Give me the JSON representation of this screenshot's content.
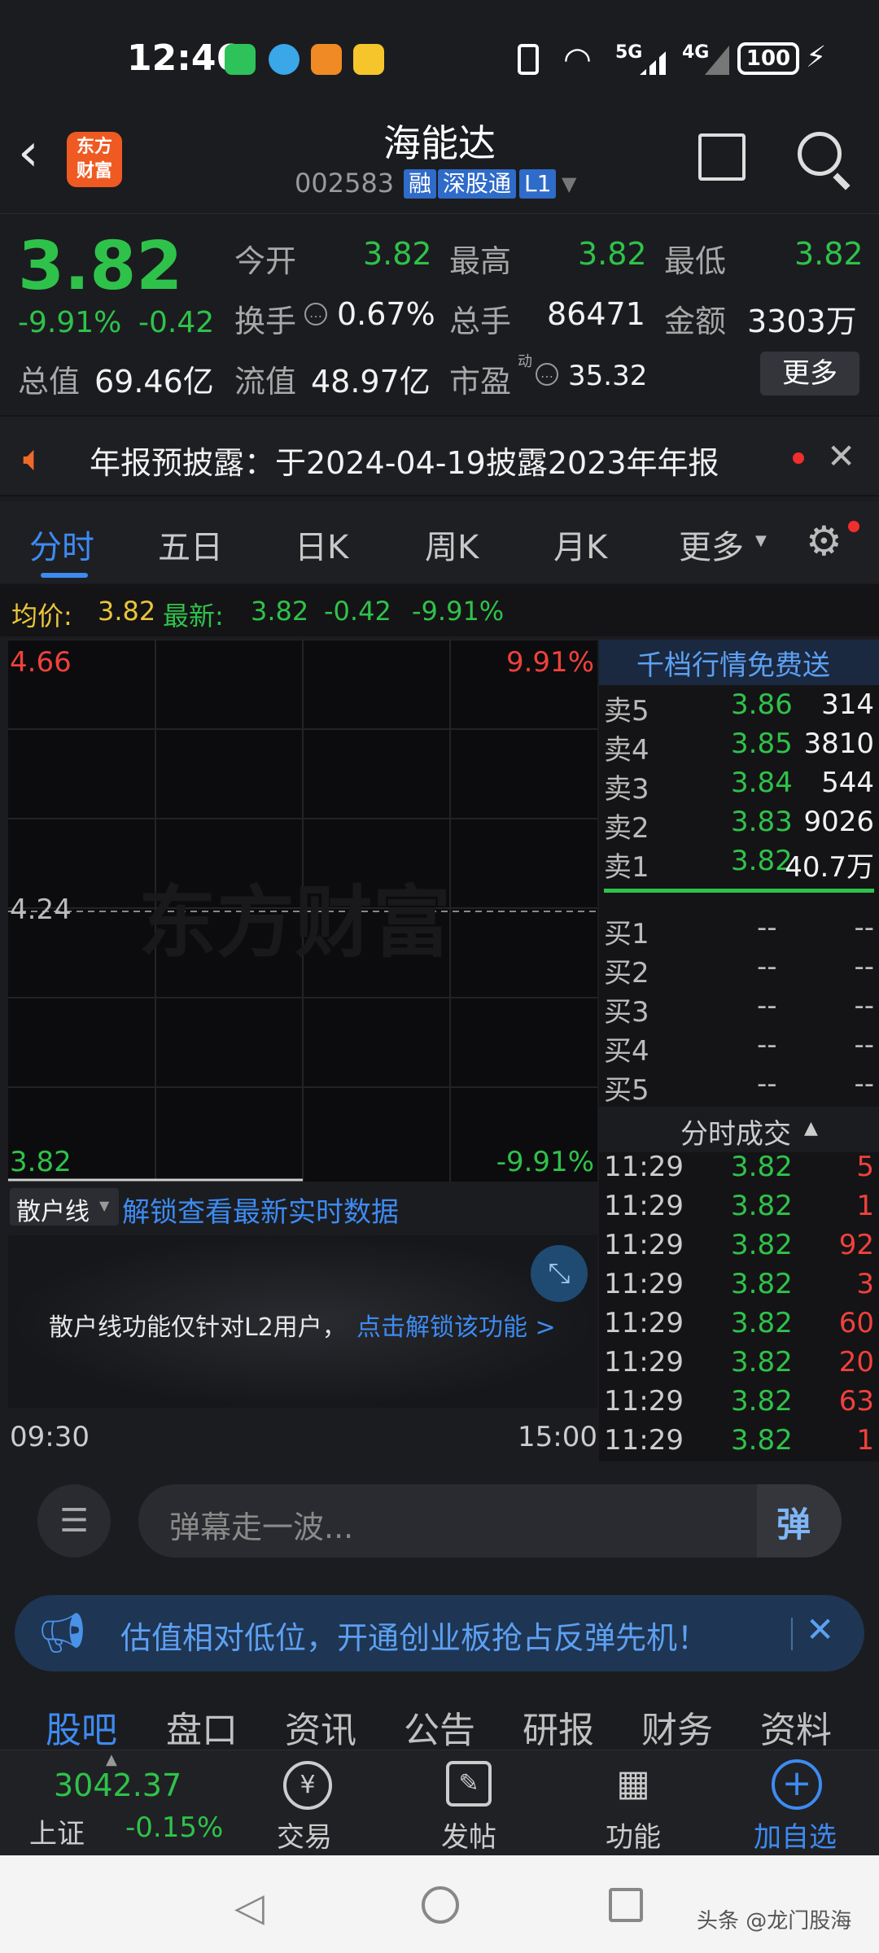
{
  "status": {
    "time": "12:46",
    "battery": "100",
    "net1": "5G",
    "net2": "4G"
  },
  "header": {
    "name": "海能达",
    "code": "002583",
    "tags": [
      "融",
      "深股通",
      "L1"
    ],
    "logo_line1": "东方",
    "logo_line2": "财富"
  },
  "quote": {
    "price": "3.82",
    "change_pct": "-9.91%",
    "change": "-0.42",
    "open_label": "今开",
    "open": "3.82",
    "high_label": "最高",
    "high": "3.82",
    "low_label": "最低",
    "low": "3.82",
    "turnover_label": "换手",
    "turnover": "0.67%",
    "volume_label": "总手",
    "volume": "86471",
    "amount_label": "金额",
    "amount": "3303万",
    "mcap_label": "总值",
    "mcap": "69.46亿",
    "float_label": "流值",
    "float": "48.97亿",
    "pe_label": "市盈",
    "pe_sup": "动",
    "pe": "35.32",
    "more": "更多"
  },
  "notice": {
    "text": "年报预披露：于2024-04-19披露2023年年报"
  },
  "tabs": [
    "分时",
    "五日",
    "日K",
    "周K",
    "月K",
    "更多"
  ],
  "infoline": {
    "avg_label": "均价:",
    "avg": "3.82",
    "last_label": "最新:",
    "last": "3.82",
    "chg": "-0.42",
    "pct": "-9.91%"
  },
  "chart": {
    "y_top": "4.66",
    "y_mid": "4.24",
    "y_bottom": "3.82",
    "pct_top": "9.91%",
    "pct_bottom": "-9.91%",
    "time_start": "09:30",
    "time_end": "15:00",
    "watermark": "东方财富",
    "retail_label": "散户线",
    "unlock_text": "解锁查看最新实时数据",
    "l2_text": "散户线功能仅针对L2用户，",
    "l2_link": "点击解锁该功能 >"
  },
  "orderbook": {
    "banner": "千档行情免费送",
    "sell": [
      {
        "label": "卖5",
        "price": "3.86",
        "vol": "314"
      },
      {
        "label": "卖4",
        "price": "3.85",
        "vol": "3810"
      },
      {
        "label": "卖3",
        "price": "3.84",
        "vol": "544"
      },
      {
        "label": "卖2",
        "price": "3.83",
        "vol": "9026"
      },
      {
        "label": "卖1",
        "price": "3.82",
        "vol": "40.7万"
      }
    ],
    "buy": [
      {
        "label": "买1",
        "price": "--",
        "vol": "--"
      },
      {
        "label": "买2",
        "price": "--",
        "vol": "--"
      },
      {
        "label": "买3",
        "price": "--",
        "vol": "--"
      },
      {
        "label": "买4",
        "price": "--",
        "vol": "--"
      },
      {
        "label": "买5",
        "price": "--",
        "vol": "--"
      }
    ],
    "trades_title": "分时成交",
    "trades": [
      {
        "time": "11:29",
        "price": "3.82",
        "vol": "5"
      },
      {
        "time": "11:29",
        "price": "3.82",
        "vol": "1"
      },
      {
        "time": "11:29",
        "price": "3.82",
        "vol": "92"
      },
      {
        "time": "11:29",
        "price": "3.82",
        "vol": "3"
      },
      {
        "time": "11:29",
        "price": "3.82",
        "vol": "60"
      },
      {
        "time": "11:29",
        "price": "3.82",
        "vol": "20"
      },
      {
        "time": "11:29",
        "price": "3.82",
        "vol": "63"
      },
      {
        "time": "11:29",
        "price": "3.82",
        "vol": "1"
      }
    ]
  },
  "danmu": {
    "placeholder": "弹幕走一波...",
    "btn": "弹"
  },
  "promo": {
    "text": "估值相对低位，开通创业板抢占反弹先机！"
  },
  "subtabs": [
    "股吧",
    "盘口",
    "资讯",
    "公告",
    "研报",
    "财务",
    "资料"
  ],
  "bottombar": {
    "index_value": "3042.37",
    "index_name": "上证",
    "index_pct": "-0.15%",
    "trade": "交易",
    "post": "发帖",
    "func": "功能",
    "add": "加自选"
  },
  "watermark": "头条 @龙门股海"
}
